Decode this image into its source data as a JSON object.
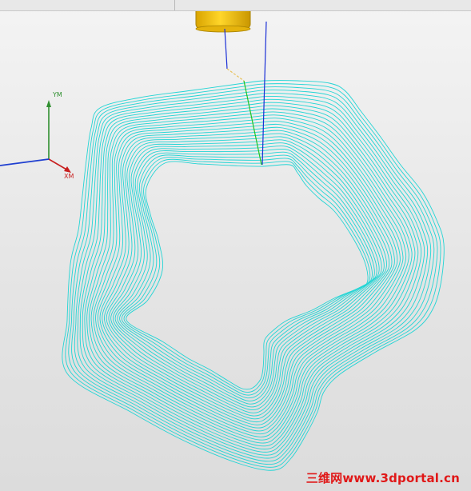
{
  "axes": {
    "y_label": "YM",
    "x_label": "XM",
    "z_label": "",
    "y_color": "#2f8f2f",
    "x_color": "#c81e1e",
    "z_color": "#1f3fd0"
  },
  "toolpath": {
    "color": "#23d5d5",
    "pass_count": 28
  },
  "tool": {
    "holder_color": "#f0c419",
    "holder_edge": "#a88300",
    "axis_color": "#1a2fd6",
    "segment_color": "#22c422"
  },
  "watermark": {
    "text": "三维网www.3dportal.cn",
    "color": "#e01818"
  }
}
